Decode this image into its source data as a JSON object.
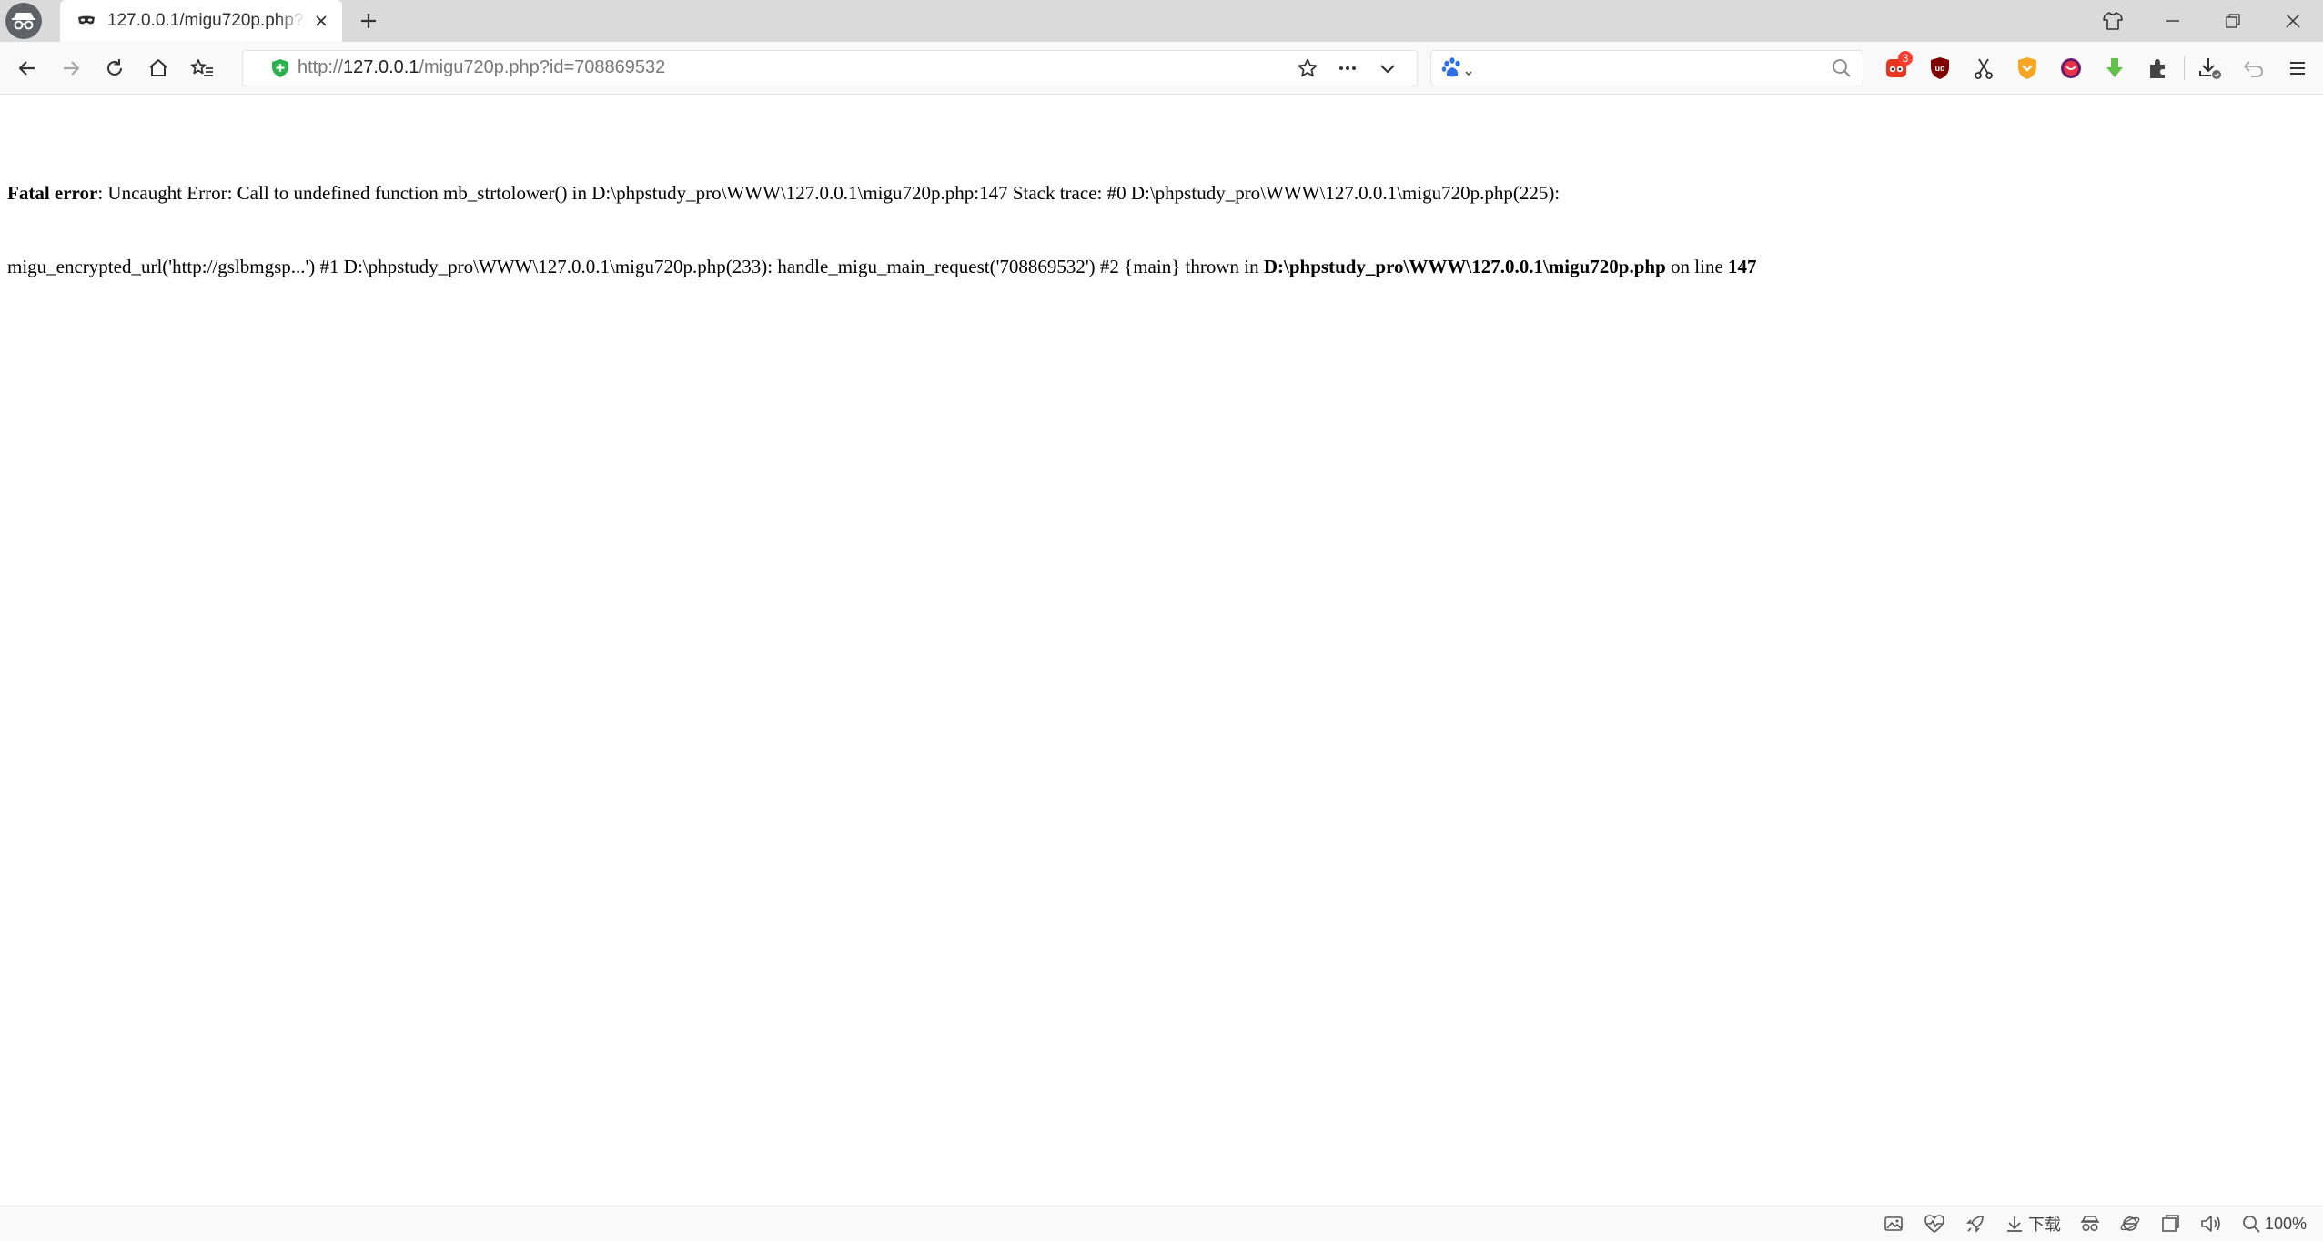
{
  "tab": {
    "title": "127.0.0.1/migu720p.php?id=708869532",
    "new_tab_label": "+"
  },
  "address_bar": {
    "url_prefix": "http://",
    "url_host": "127.0.0.1",
    "url_path": "/migu720p.php?id=708869532"
  },
  "search": {
    "value": "",
    "engine_icon": "baidu-paw-icon"
  },
  "extensions": {
    "notification_count": "3",
    "items": [
      "reader-extension-icon",
      "ublock-icon",
      "screenshot-scissors-icon",
      "shield-ext-icon",
      "red-circle-ext-icon",
      "green-download-ext-icon",
      "puzzle-extensions-icon"
    ]
  },
  "error": {
    "label": "Fatal error",
    "line1_rest": ": Uncaught Error: Call to undefined function mb_strtolower() in D:\\phpstudy_pro\\WWW\\127.0.0.1\\migu720p.php:147 Stack trace: #0 D:\\phpstudy_pro\\WWW\\127.0.0.1\\migu720p.php(225):",
    "line2_main": "migu_encrypted_url('http://gslbmgsp...') #1 D:\\phpstudy_pro\\WWW\\127.0.0.1\\migu720p.php(233): handle_migu_main_request('708869532') #2 {main} thrown in ",
    "file_bold": "D:\\phpstudy_pro\\WWW\\127.0.0.1\\migu720p.php",
    "on_line": " on line ",
    "line_bold": "147"
  },
  "status_bar": {
    "download_label": "下载",
    "zoom": "100%"
  },
  "colors": {
    "tabstrip": "#dadada",
    "toolbar": "#f9f9f9",
    "secure_green": "#2bb24c",
    "badge_red": "#ff3b30"
  }
}
